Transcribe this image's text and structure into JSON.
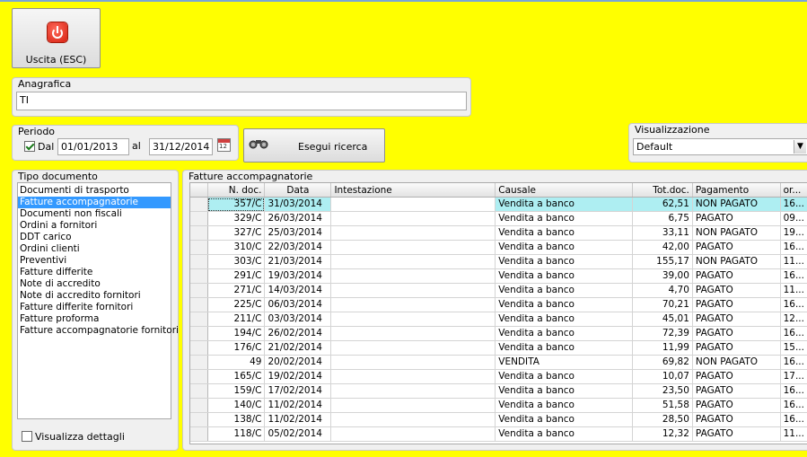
{
  "exit_button": {
    "label": "Uscita (ESC)",
    "icon": "power-icon"
  },
  "anagrafica": {
    "caption": "Anagrafica",
    "value": "TI"
  },
  "periodo": {
    "caption": "Periodo",
    "dal_label": "Dal",
    "dal_checked": true,
    "dal_value": "01/01/2013",
    "al_label": "al",
    "al_value": "31/12/2014"
  },
  "search_button": {
    "label": "Esegui ricerca",
    "icon": "binoculars-icon"
  },
  "visualizzazione": {
    "caption": "Visualizzazione",
    "selected": "Default"
  },
  "tipo_documento": {
    "caption": "Tipo documento",
    "items": [
      "Documenti di trasporto",
      "Fatture accompagnatorie",
      "Documenti non fiscali",
      "Ordini a fornitori",
      "DDT carico",
      "Ordini clienti",
      "Preventivi",
      "Fatture differite",
      "Note di accredito",
      "Note di accredito fornitori",
      "Fatture differite fornitori",
      "Fatture proforma",
      "Fatture accompagnatorie fornitori"
    ],
    "selected_index": 1,
    "dettagli_label": "Visualizza dettagli",
    "dettagli_checked": false
  },
  "grid": {
    "caption": "Fatture accompagnatorie",
    "columns": [
      "N. doc.",
      "Data",
      "Intestazione",
      "Causale",
      "Tot.doc.",
      "Pagamento",
      "or..."
    ],
    "rows": [
      [
        "357/C",
        "31/03/2014",
        "",
        "Vendita a banco",
        "62,51",
        "NON PAGATO",
        "16..."
      ],
      [
        "329/C",
        "26/03/2014",
        "",
        "Vendita a banco",
        "6,75",
        "PAGATO",
        "09..."
      ],
      [
        "327/C",
        "25/03/2014",
        "",
        "Vendita a banco",
        "33,11",
        "NON PAGATO",
        "19..."
      ],
      [
        "310/C",
        "22/03/2014",
        "",
        "Vendita a banco",
        "42,00",
        "PAGATO",
        "16..."
      ],
      [
        "303/C",
        "21/03/2014",
        "",
        "Vendita a banco",
        "155,17",
        "NON PAGATO",
        "11..."
      ],
      [
        "291/C",
        "19/03/2014",
        "",
        "Vendita a banco",
        "39,00",
        "PAGATO",
        "16..."
      ],
      [
        "271/C",
        "14/03/2014",
        "",
        "Vendita a banco",
        "4,70",
        "PAGATO",
        "11..."
      ],
      [
        "225/C",
        "06/03/2014",
        "",
        "Vendita a banco",
        "70,21",
        "PAGATO",
        "16..."
      ],
      [
        "211/C",
        "03/03/2014",
        "",
        "Vendita a banco",
        "45,01",
        "PAGATO",
        "12..."
      ],
      [
        "194/C",
        "26/02/2014",
        "",
        "Vendita a banco",
        "72,39",
        "PAGATO",
        "16..."
      ],
      [
        "176/C",
        "21/02/2014",
        "",
        "Vendita a banco",
        "11,99",
        "PAGATO",
        "15..."
      ],
      [
        "49",
        "20/02/2014",
        "",
        "VENDITA",
        "69,82",
        "NON PAGATO",
        "16..."
      ],
      [
        "165/C",
        "19/02/2014",
        "",
        "Vendita a banco",
        "10,07",
        "PAGATO",
        "17..."
      ],
      [
        "159/C",
        "17/02/2014",
        "",
        "Vendita a banco",
        "23,50",
        "PAGATO",
        "16..."
      ],
      [
        "140/C",
        "11/02/2014",
        "",
        "Vendita a banco",
        "51,58",
        "PAGATO",
        "16..."
      ],
      [
        "138/C",
        "11/02/2014",
        "",
        "Vendita a banco",
        "28,50",
        "PAGATO",
        "16..."
      ],
      [
        "118/C",
        "05/02/2014",
        "",
        "Vendita a banco",
        "12,32",
        "PAGATO",
        "11..."
      ]
    ],
    "selected_row": 0
  }
}
